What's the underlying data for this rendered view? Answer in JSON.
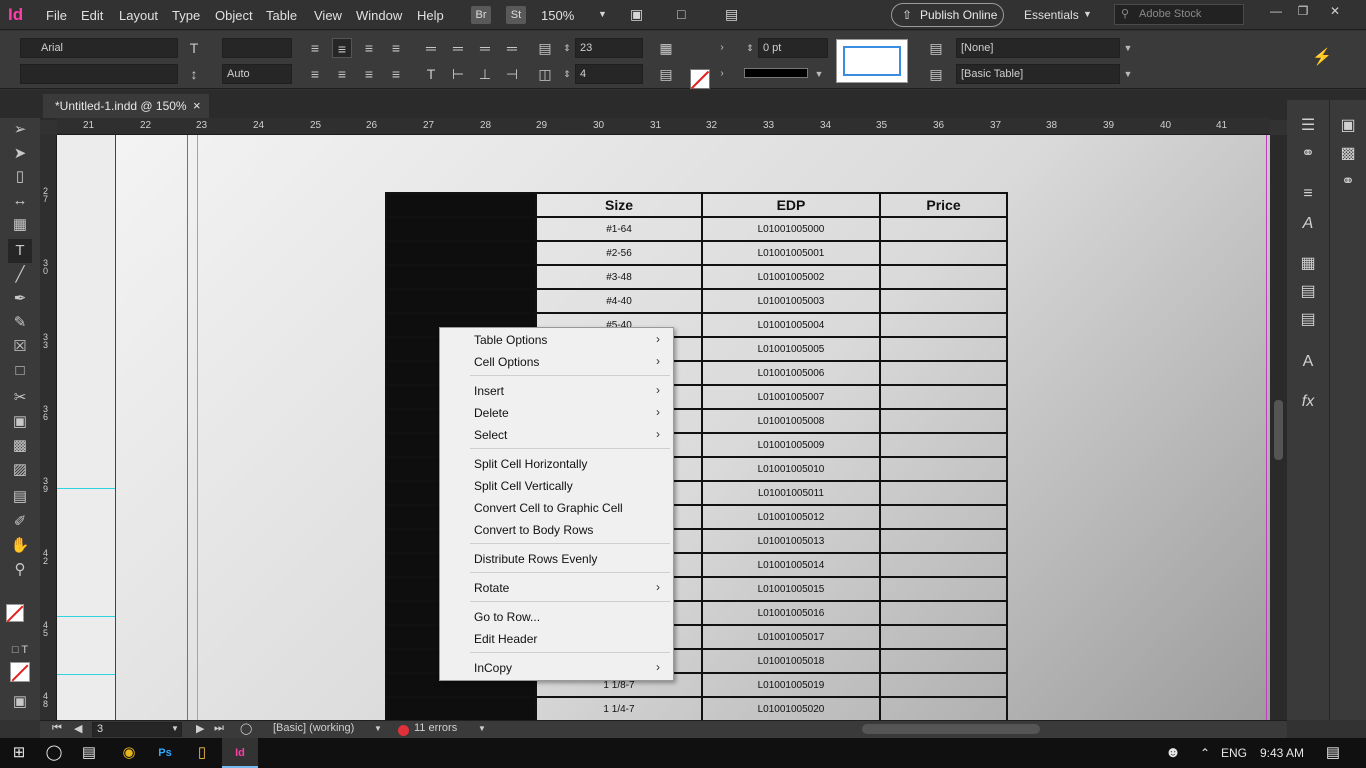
{
  "app": {
    "logo": "Id"
  },
  "menubar": {
    "items": [
      "File",
      "Edit",
      "Layout",
      "Type",
      "Object",
      "Table",
      "View",
      "Window",
      "Help"
    ],
    "bridge": "Br",
    "stock_chip": "St",
    "zoom": "150%",
    "publish_online": "Publish Online",
    "workspace": "Essentials",
    "search_placeholder": "Adobe Stock",
    "window_buttons": {
      "minimize": "—",
      "restore": "❐",
      "close": "✕"
    }
  },
  "control_panel": {
    "font_family": "Arial",
    "font_style": "",
    "font_size": "",
    "leading": "Auto",
    "rows_label_t": "T",
    "row_count": "23",
    "column_count": "4",
    "stroke_weight": "0 pt",
    "cell_style": "[None]",
    "table_style": "[Basic Table]"
  },
  "document_tab": {
    "title": "*Untitled-1.indd @ 150%",
    "close": "×"
  },
  "ruler": {
    "horizontal": [
      "21",
      "22",
      "23",
      "24",
      "25",
      "26",
      "27",
      "28",
      "29",
      "30",
      "31",
      "32",
      "33",
      "34",
      "35",
      "36",
      "37",
      "38",
      "39",
      "40",
      "41"
    ],
    "vertical": [
      "2\n7",
      "3\n0",
      "3\n3",
      "3\n6",
      "3\n9",
      "4\n2",
      "4\n5",
      "4\n8"
    ]
  },
  "table": {
    "headers": [
      "Size",
      "EDP",
      "Price"
    ],
    "rows": [
      {
        "size": "#1-64",
        "edp": "L01001005000"
      },
      {
        "size": "#2-56",
        "edp": "L01001005001"
      },
      {
        "size": "#3-48",
        "edp": "L01001005002"
      },
      {
        "size": "#4-40",
        "edp": "L01001005003"
      },
      {
        "size": "#5-40",
        "edp": "L01001005004"
      },
      {
        "size": "",
        "edp": "L01001005005"
      },
      {
        "size": "",
        "edp": "L01001005006"
      },
      {
        "size": "",
        "edp": "L01001005007"
      },
      {
        "size": "",
        "edp": "L01001005008"
      },
      {
        "size": "",
        "edp": "L01001005009"
      },
      {
        "size": "",
        "edp": "L01001005010"
      },
      {
        "size": "",
        "edp": "L01001005011"
      },
      {
        "size": "",
        "edp": "L01001005012"
      },
      {
        "size": "",
        "edp": "L01001005013"
      },
      {
        "size": "",
        "edp": "L01001005014"
      },
      {
        "size": "",
        "edp": "L01001005015"
      },
      {
        "size": "",
        "edp": "L01001005016"
      },
      {
        "size": "",
        "edp": "L01001005017"
      },
      {
        "size": "",
        "edp": "L01001005018"
      },
      {
        "size": "1 1/8-7",
        "edp": "L01001005019"
      },
      {
        "size": "1 1/4-7",
        "edp": "L01001005020"
      }
    ]
  },
  "context_menu": {
    "table_options": "Table Options",
    "cell_options": "Cell Options",
    "insert": "Insert",
    "delete": "Delete",
    "select": "Select",
    "split_h": "Split Cell Horizontally",
    "split_v": "Split Cell Vertically",
    "convert_graphic": "Convert Cell to Graphic Cell",
    "convert_body": "Convert to Body Rows",
    "distribute_rows": "Distribute Rows Evenly",
    "rotate": "Rotate",
    "go_to_row": "Go to Row...",
    "edit_header": "Edit Header",
    "incopy": "InCopy",
    "submenu_arrow": "›"
  },
  "status_bar": {
    "page": "3",
    "preflight_profile": "[Basic] (working)",
    "errors": "11 errors"
  },
  "taskbar": {
    "language": "ENG",
    "time": "9:43 AM"
  },
  "colors": {
    "accent_blue": "#3a8de0",
    "error_red": "#e0313b",
    "indesign_pink": "#ff3da8"
  }
}
